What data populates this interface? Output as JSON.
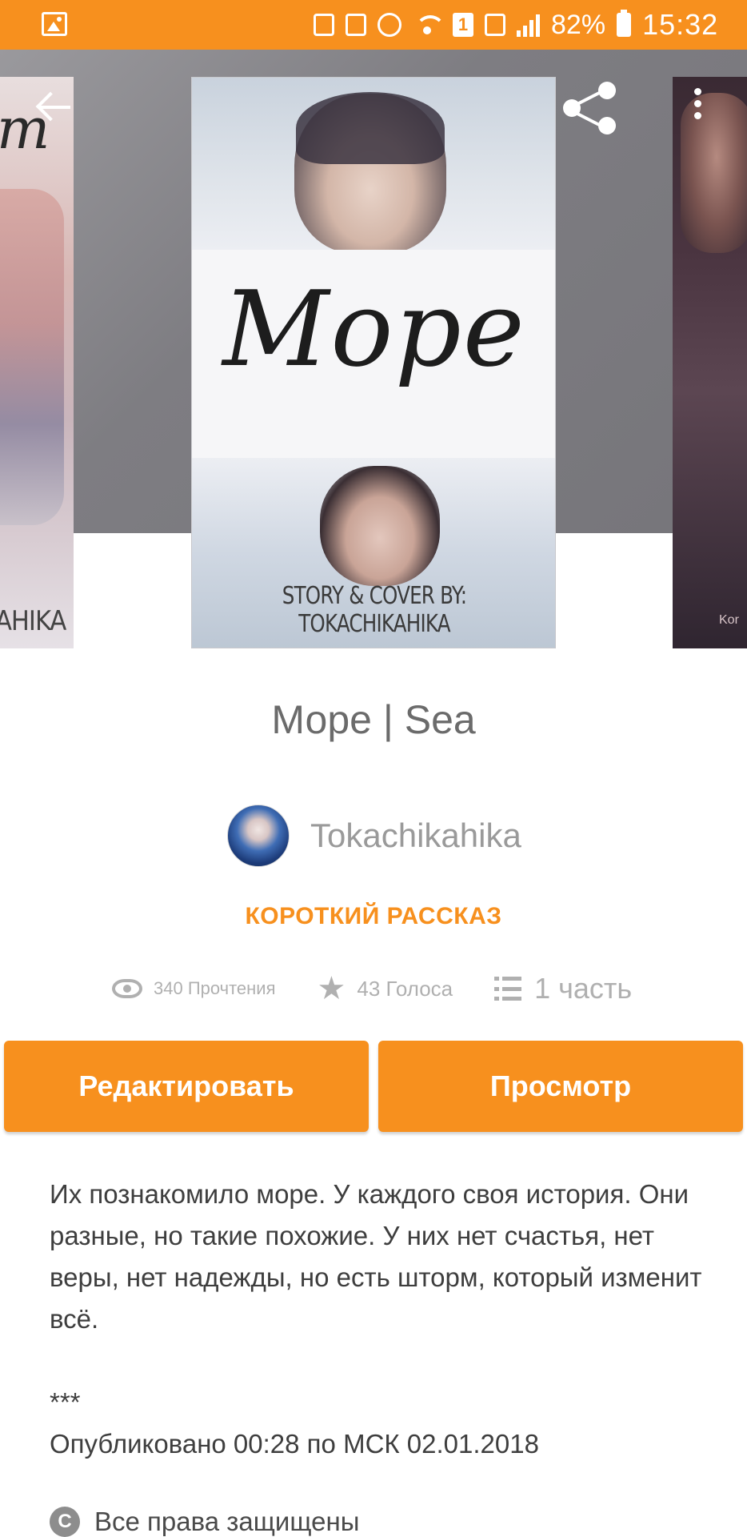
{
  "status_bar": {
    "battery": "82%",
    "time": "15:32",
    "sim_number": "1"
  },
  "covers": {
    "main": {
      "title": "Море",
      "credit": "STORY & COVER BY: TOKACHIKAHIKA"
    },
    "left": {
      "credit": "AHIKA",
      "script": "m"
    },
    "right": {
      "credit": "Kor"
    }
  },
  "story": {
    "title": "Море | Sea",
    "author": "Tokachikahika",
    "genre": "КОРОТКИЙ РАССКАЗ",
    "stats": {
      "reads": "340 Прочтения",
      "votes": "43 Голоса",
      "parts": "1 часть"
    }
  },
  "actions": {
    "edit_label": "Редактировать",
    "view_label": "Просмотр"
  },
  "description": {
    "paragraph": "Их познакомило море. У каждого своя история. Они разные, но такие похожие. У них нет счастья, нет веры, нет надежды, но есть шторм, который изменит всё.",
    "stars": "***",
    "published": "Опубликовано 00:28 по МСК 02.01.2018"
  },
  "rights": {
    "icon_glyph": "C",
    "text": "Все права защищены"
  },
  "colors": {
    "accent": "#f7901e",
    "hero_bg": "#7d7c80",
    "text_muted": "#b0b0b0"
  },
  "icons": {
    "back": "arrow-left-icon",
    "share": "share-icon",
    "more": "more-vertical-icon",
    "reads": "eye-icon",
    "votes": "star-icon",
    "parts": "list-icon",
    "rights": "copyright-icon"
  }
}
